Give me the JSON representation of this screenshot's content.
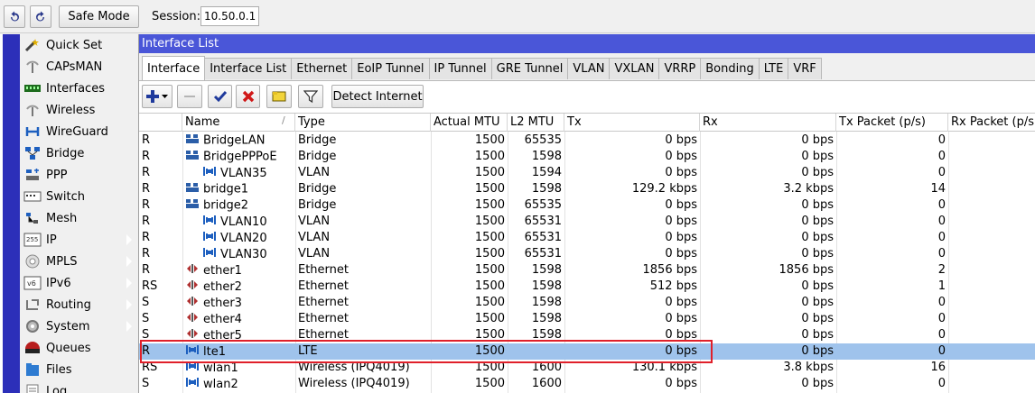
{
  "toolbar": {
    "undo_icon": "undo-icon",
    "redo_icon": "redo-icon",
    "safe_mode_label": "Safe Mode",
    "session_label": "Session:",
    "session_value": "10.50.0.1"
  },
  "sidebar": {
    "items": [
      {
        "label": "Quick Set",
        "icon": "wand-icon",
        "submenu": false
      },
      {
        "label": "CAPsMAN",
        "icon": "capsman-icon",
        "submenu": false
      },
      {
        "label": "Interfaces",
        "icon": "interfaces-icon",
        "submenu": false
      },
      {
        "label": "Wireless",
        "icon": "wireless-icon",
        "submenu": false
      },
      {
        "label": "WireGuard",
        "icon": "wireguard-icon",
        "submenu": false
      },
      {
        "label": "Bridge",
        "icon": "bridge-icon",
        "submenu": false
      },
      {
        "label": "PPP",
        "icon": "ppp-icon",
        "submenu": false
      },
      {
        "label": "Switch",
        "icon": "switch-icon",
        "submenu": false
      },
      {
        "label": "Mesh",
        "icon": "mesh-icon",
        "submenu": false
      },
      {
        "label": "IP",
        "icon": "ip-icon",
        "submenu": true
      },
      {
        "label": "MPLS",
        "icon": "mpls-icon",
        "submenu": true
      },
      {
        "label": "IPv6",
        "icon": "ipv6-icon",
        "submenu": true
      },
      {
        "label": "Routing",
        "icon": "routing-icon",
        "submenu": true
      },
      {
        "label": "System",
        "icon": "system-icon",
        "submenu": true
      },
      {
        "label": "Queues",
        "icon": "queues-icon",
        "submenu": false
      },
      {
        "label": "Files",
        "icon": "files-icon",
        "submenu": false
      },
      {
        "label": "Log",
        "icon": "log-icon",
        "submenu": false
      }
    ]
  },
  "window": {
    "title": "Interface List",
    "tabs": [
      "Interface",
      "Interface List",
      "Ethernet",
      "EoIP Tunnel",
      "IP Tunnel",
      "GRE Tunnel",
      "VLAN",
      "VXLAN",
      "VRRP",
      "Bonding",
      "LTE",
      "VRF"
    ],
    "active_tab": "Interface",
    "actions": {
      "add_icon": "plus-icon",
      "remove_icon": "minus-icon",
      "enable_icon": "check-icon",
      "disable_icon": "x-icon",
      "comment_icon": "comment-icon",
      "filter_icon": "filter-icon",
      "detect_label": "Detect Internet"
    }
  },
  "table": {
    "columns": [
      "",
      "Name",
      "Type",
      "Actual MTU",
      "L2 MTU",
      "Tx",
      "Rx",
      "Tx Packet (p/s)",
      "Rx Packet (p/s)"
    ],
    "rows": [
      {
        "flag": "R",
        "name": "BridgeLAN",
        "type": "Bridge",
        "mtu": "1500",
        "l2mtu": "65535",
        "tx": "0 bps",
        "rx": "0 bps",
        "txp": "0",
        "icon": "bridge",
        "indent": false
      },
      {
        "flag": "R",
        "name": "BridgePPPoE",
        "type": "Bridge",
        "mtu": "1500",
        "l2mtu": "1598",
        "tx": "0 bps",
        "rx": "0 bps",
        "txp": "0",
        "icon": "bridge",
        "indent": false
      },
      {
        "flag": "R",
        "name": "VLAN35",
        "type": "VLAN",
        "mtu": "1500",
        "l2mtu": "1594",
        "tx": "0 bps",
        "rx": "0 bps",
        "txp": "0",
        "icon": "vlan",
        "indent": true
      },
      {
        "flag": "R",
        "name": "bridge1",
        "type": "Bridge",
        "mtu": "1500",
        "l2mtu": "1598",
        "tx": "129.2 kbps",
        "rx": "3.2 kbps",
        "txp": "14",
        "icon": "bridge",
        "indent": false
      },
      {
        "flag": "R",
        "name": "bridge2",
        "type": "Bridge",
        "mtu": "1500",
        "l2mtu": "65535",
        "tx": "0 bps",
        "rx": "0 bps",
        "txp": "0",
        "icon": "bridge",
        "indent": false
      },
      {
        "flag": "R",
        "name": "VLAN10",
        "type": "VLAN",
        "mtu": "1500",
        "l2mtu": "65531",
        "tx": "0 bps",
        "rx": "0 bps",
        "txp": "0",
        "icon": "vlan",
        "indent": true
      },
      {
        "flag": "R",
        "name": "VLAN20",
        "type": "VLAN",
        "mtu": "1500",
        "l2mtu": "65531",
        "tx": "0 bps",
        "rx": "0 bps",
        "txp": "0",
        "icon": "vlan",
        "indent": true
      },
      {
        "flag": "R",
        "name": "VLAN30",
        "type": "VLAN",
        "mtu": "1500",
        "l2mtu": "65531",
        "tx": "0 bps",
        "rx": "0 bps",
        "txp": "0",
        "icon": "vlan",
        "indent": true
      },
      {
        "flag": "R",
        "name": "ether1",
        "type": "Ethernet",
        "mtu": "1500",
        "l2mtu": "1598",
        "tx": "1856 bps",
        "rx": "1856 bps",
        "txp": "2",
        "icon": "ether",
        "indent": false
      },
      {
        "flag": "RS",
        "name": "ether2",
        "type": "Ethernet",
        "mtu": "1500",
        "l2mtu": "1598",
        "tx": "512 bps",
        "rx": "0 bps",
        "txp": "1",
        "icon": "ether",
        "indent": false
      },
      {
        "flag": "S",
        "name": "ether3",
        "type": "Ethernet",
        "mtu": "1500",
        "l2mtu": "1598",
        "tx": "0 bps",
        "rx": "0 bps",
        "txp": "0",
        "icon": "ether",
        "indent": false
      },
      {
        "flag": "S",
        "name": "ether4",
        "type": "Ethernet",
        "mtu": "1500",
        "l2mtu": "1598",
        "tx": "0 bps",
        "rx": "0 bps",
        "txp": "0",
        "icon": "ether",
        "indent": false
      },
      {
        "flag": "S",
        "name": "ether5",
        "type": "Ethernet",
        "mtu": "1500",
        "l2mtu": "1598",
        "tx": "0 bps",
        "rx": "0 bps",
        "txp": "0",
        "icon": "ether",
        "indent": false
      },
      {
        "flag": "R",
        "name": "lte1",
        "type": "LTE",
        "mtu": "1500",
        "l2mtu": "",
        "tx": "0 bps",
        "rx": "0 bps",
        "txp": "0",
        "icon": "vlan",
        "indent": false,
        "selected": true
      },
      {
        "flag": "RS",
        "name": "wlan1",
        "type": "Wireless (IPQ4019)",
        "mtu": "1500",
        "l2mtu": "1600",
        "tx": "130.1 kbps",
        "rx": "3.8 kbps",
        "txp": "16",
        "icon": "vlan",
        "indent": false
      },
      {
        "flag": "S",
        "name": "wlan2",
        "type": "Wireless (IPQ4019)",
        "mtu": "1500",
        "l2mtu": "1600",
        "tx": "0 bps",
        "rx": "0 bps",
        "txp": "0",
        "icon": "vlan",
        "indent": false
      }
    ]
  },
  "colors": {
    "title_bar": "#4a56d8",
    "left_strip": "#2c2fb9",
    "selected_row": "#9fc3ec",
    "highlight_box": "#e0202a"
  }
}
